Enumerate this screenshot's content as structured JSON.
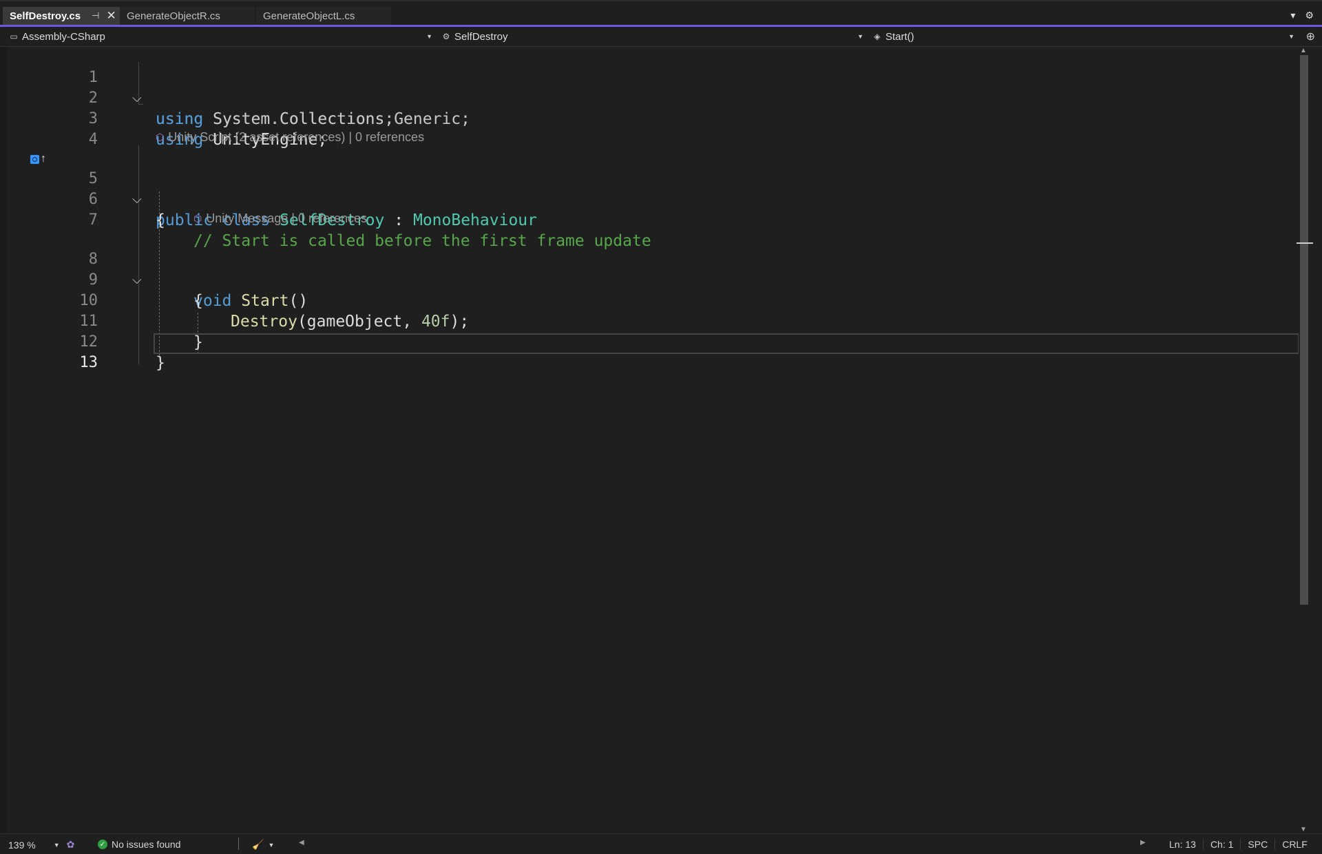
{
  "tabs": [
    {
      "label": "SelfDestroy.cs",
      "active": true
    },
    {
      "label": "GenerateObjectR.cs",
      "active": false
    },
    {
      "label": "GenerateObjectL.cs",
      "active": false
    }
  ],
  "navbar": {
    "project": "Assembly-CSharp",
    "type": "SelfDestroy",
    "member": "Start()"
  },
  "codelens": {
    "class": {
      "label": "Unity Script (2 asset references)",
      "refs": "0 references"
    },
    "method": {
      "label": "Unity Message",
      "refs": "0 references"
    }
  },
  "line_numbers": [
    "1",
    "2",
    "3",
    "4",
    "5",
    "6",
    "7",
    "8",
    "9",
    "10",
    "11",
    "12",
    "13"
  ],
  "code": {
    "l1": {
      "kw": "using",
      "ns": "System.Collections;"
    },
    "l2": {
      "kw": "using",
      "ns": "System.Collections.Generic;"
    },
    "l3": {
      "kw": "using",
      "ns": "UnityEngine;"
    },
    "l5": {
      "kw1": "public",
      "kw2": "class",
      "name": "SelfDestroy",
      "colon": ":",
      "base": "MonoBehaviour"
    },
    "l6": "{",
    "l7": "// Start is called before the first frame update",
    "l8": {
      "kw": "void",
      "fn": "Start",
      "parens": "()"
    },
    "l9": "{",
    "l10": {
      "fn": "Destroy",
      "open": "(gameObject, ",
      "num": "40f",
      "close": ");"
    },
    "l11": "}",
    "l12": "}"
  },
  "status": {
    "zoom": "139 %",
    "issues": "No issues found",
    "ln": "Ln: 13",
    "ch": "Ch: 1",
    "spacing": "SPC",
    "eol": "CRLF"
  },
  "colors": {
    "keyword": "#569cd6",
    "type": "#4ec9b0",
    "method": "#dcdcaa",
    "comment": "#57a64a",
    "number": "#b5cea8",
    "accent": "#6b5ae0"
  }
}
